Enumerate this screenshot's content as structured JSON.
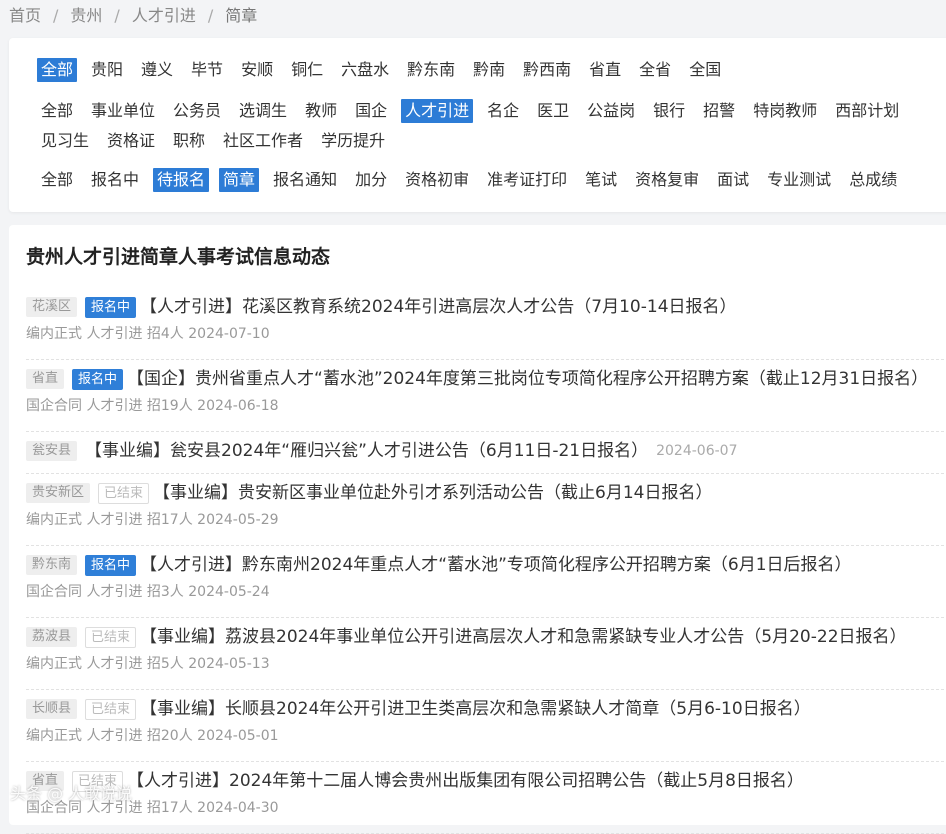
{
  "breadcrumb": [
    "首页",
    "贵州",
    "人才引进",
    "简章"
  ],
  "filters": {
    "regions": [
      "全部",
      "贵阳",
      "遵义",
      "毕节",
      "安顺",
      "铜仁",
      "六盘水",
      "黔东南",
      "黔南",
      "黔西南",
      "省直",
      "全省",
      "全国"
    ],
    "regions_active": 0,
    "categories_line1": [
      "全部",
      "事业单位",
      "公务员",
      "选调生",
      "教师",
      "国企",
      "人才引进",
      "名企",
      "医卫",
      "公益岗",
      "银行",
      "招警",
      "特岗教师",
      "西部计划"
    ],
    "categories_line2": [
      "见习生",
      "资格证",
      "职称",
      "社区工作者",
      "学历提升"
    ],
    "categories_active": 6,
    "stages": [
      "全部",
      "报名中",
      "待报名",
      "简章",
      "报名通知",
      "加分",
      "资格初审",
      "准考证打印",
      "笔试",
      "资格复审",
      "面试",
      "专业测试",
      "总成绩"
    ],
    "stages_active": [
      2,
      3
    ]
  },
  "list": {
    "title": "贵州人才引进简章人事考试信息动态",
    "items": [
      {
        "region": "花溪区",
        "status": "报名中",
        "title": "【人才引进】花溪区教育系统2024年引进高层次人才公告（7月10-14日报名）",
        "meta": "编内正式 人才引进 招4人 2024-07-10"
      },
      {
        "region": "省直",
        "status": "报名中",
        "title": "【国企】贵州省重点人才“蓄水池”2024年度第三批岗位专项简化程序公开招聘方案（截止12月31日报名）",
        "meta": "国企合同 人才引进 招19人 2024-06-18"
      },
      {
        "region": "瓮安县",
        "status": "",
        "title": "【事业编】瓮安县2024年“雁归兴瓮”人才引进公告（6月11日-21日报名）",
        "date": "2024-06-07",
        "meta": ""
      },
      {
        "region": "贵安新区",
        "status": "已结束",
        "title": "【事业编】贵安新区事业单位赴外引才系列活动公告（截止6月14日报名）",
        "meta": "编内正式 人才引进 招17人 2024-05-29"
      },
      {
        "region": "黔东南",
        "status": "报名中",
        "title": "【人才引进】黔东南州2024年重点人才“蓄水池”专项简化程序公开招聘方案（6月1日后报名）",
        "meta": "国企合同 人才引进 招3人 2024-05-24"
      },
      {
        "region": "荔波县",
        "status": "已结束",
        "title": "【事业编】荔波县2024年事业单位公开引进高层次人才和急需紧缺专业人才公告（5月20-22日报名）",
        "meta": "编内正式 人才引进 招5人 2024-05-13"
      },
      {
        "region": "长顺县",
        "status": "已结束",
        "title": "【事业编】长顺县2024年公开引进卫生类高层次和急需紧缺人才简章（5月6-10日报名）",
        "meta": "编内正式 人才引进 招20人 2024-05-01"
      },
      {
        "region": "省直",
        "status": "已结束",
        "title": "【人才引进】2024年第十二届人博会贵州出版集团有限公司招聘公告（截止5月8日报名）",
        "meta": "国企合同 人才引进 招17人 2024-04-30"
      }
    ]
  },
  "watermark": "头条 @ 人敢说说",
  "colors": {
    "accent": "#2d7cd6",
    "background": "#f3f4f6"
  }
}
